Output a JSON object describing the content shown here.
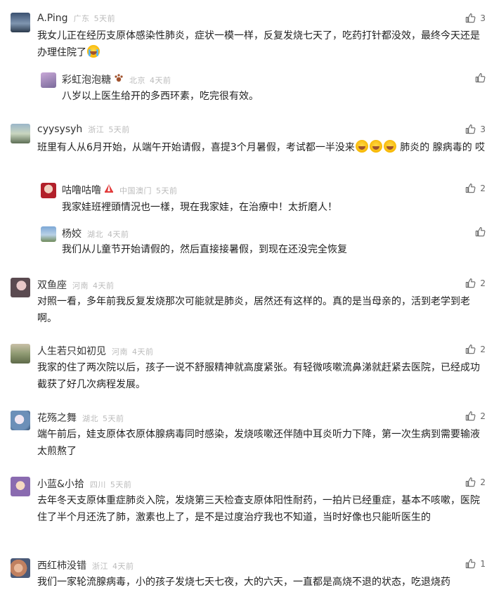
{
  "comments": [
    {
      "name": "A.Ping",
      "location": "广东",
      "time": "5天前",
      "likes": "3",
      "text": "我女儿正在经历支原体感染性肺炎，症状一模一样，反复发烧七天了，吃药打针都没效，最终今天还是办理住院了",
      "replies": [
        {
          "name": "彩虹泡泡糖",
          "location": "北京",
          "time": "4天前",
          "likes": "",
          "text": "八岁以上医生给开的多西环素，吃完很有效。"
        }
      ]
    },
    {
      "name": "cyysysyh",
      "location": "浙江",
      "time": "5天前",
      "likes": "3",
      "text_a": "班里有人从6月开始，从端午开始请假，喜提3个月暑假，考试都一半没来",
      "text_b": "肺炎的 腺病毒的 哎",
      "replies": [
        {
          "name": "咕噜咕噜",
          "location": "中国澳门",
          "time": "5天前",
          "likes": "2",
          "text": "我家娃班裡頭情況也一樣，現在我家娃，在治療中！太折磨人！"
        },
        {
          "name": "杨姣",
          "location": "湖北",
          "time": "4天前",
          "likes": "",
          "text": "我们从儿童节开始请假的，然后直接接暑假，到现在还没完全恢复"
        }
      ]
    },
    {
      "name": "双鱼座",
      "location": "河南",
      "time": "4天前",
      "likes": "2",
      "text": "对照一看，多年前我反复发烧那次可能就是肺炎，居然还有这样的。真的是当母亲的，活到老学到老啊。"
    },
    {
      "name": "人生若只如初见",
      "location": "河南",
      "time": "4天前",
      "likes": "2",
      "text": "我家的住了两次院以后，孩子一说不舒服精神就高度紧张。有轻微咳嗽流鼻涕就赶紧去医院，已经成功截获了好几次病程发展。"
    },
    {
      "name": "花殇之舞",
      "location": "湖北",
      "time": "5天前",
      "likes": "2",
      "text": "端午前后，娃支原体衣原体腺病毒同时感染，发烧咳嗽还伴随中耳炎听力下降，第一次生病到需要输液太煎熬了"
    },
    {
      "name": "小蓝&小拾",
      "location": "四川",
      "time": "5天前",
      "likes": "2",
      "text": "去年冬天支原体重症肺炎入院，发烧第三天检查支原体阳性耐药，一拍片已经重症，基本不咳嗽，医院住了半个月还洗了肺，激素也上了，是不是过度治疗我也不知道，当时好像也只能听医生的"
    },
    {
      "name": "西红柿没错",
      "location": "浙江",
      "time": "4天前",
      "likes": "1",
      "text": "我们一家轮流腺病毒，小的孩子发烧七天七夜，大的六天，一直都是高烧不退的状态，吃退烧药"
    }
  ],
  "colors": {
    "text": "#222222",
    "meta": "#bbbbbb",
    "like": "#666666"
  },
  "icons": {
    "like": "thumbs-up-icon"
  }
}
